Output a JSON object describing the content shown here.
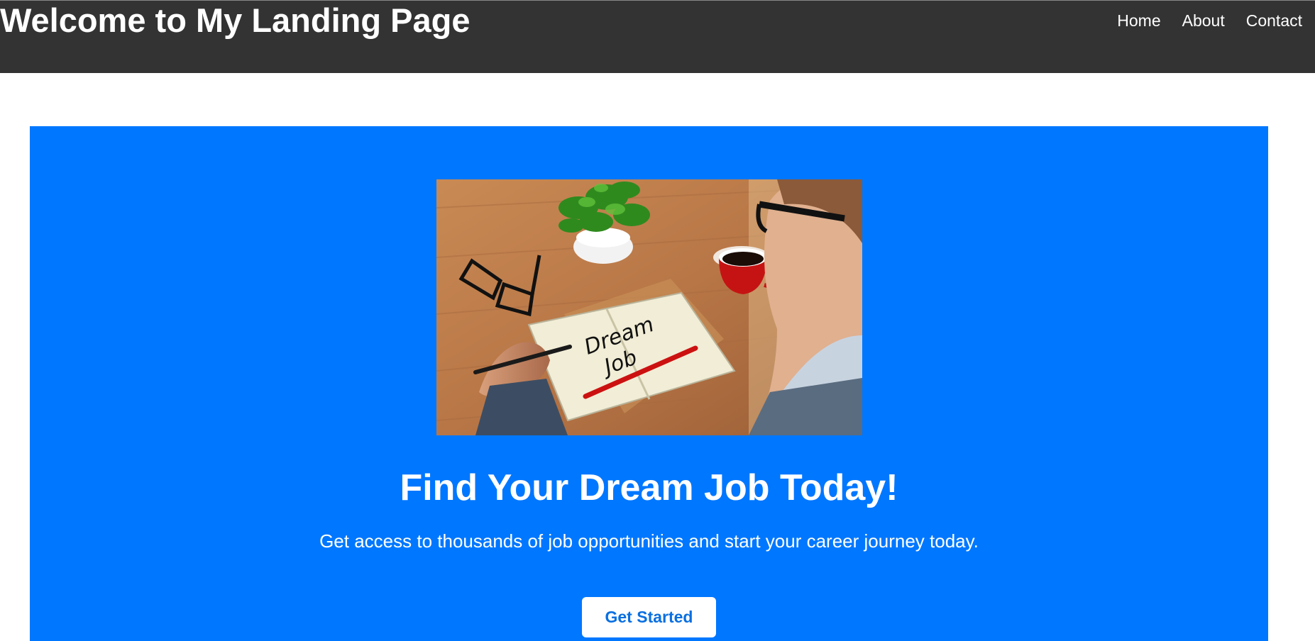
{
  "header": {
    "title": "Welcome to My Landing Page",
    "nav": [
      {
        "label": "Home"
      },
      {
        "label": "About"
      },
      {
        "label": "Contact"
      }
    ]
  },
  "hero": {
    "image": {
      "alt": "Dream Job",
      "notebook_text_line1": "Dream",
      "notebook_text_line2": "Job"
    },
    "title": "Find Your Dream Job Today!",
    "subtitle": "Get access to thousands of job opportunities and start your career journey today.",
    "cta_label": "Get Started"
  },
  "colors": {
    "header_bg": "#333333",
    "hero_bg": "#0077ff",
    "cta_bg": "#ffffff",
    "cta_text": "#0a6fe0"
  }
}
